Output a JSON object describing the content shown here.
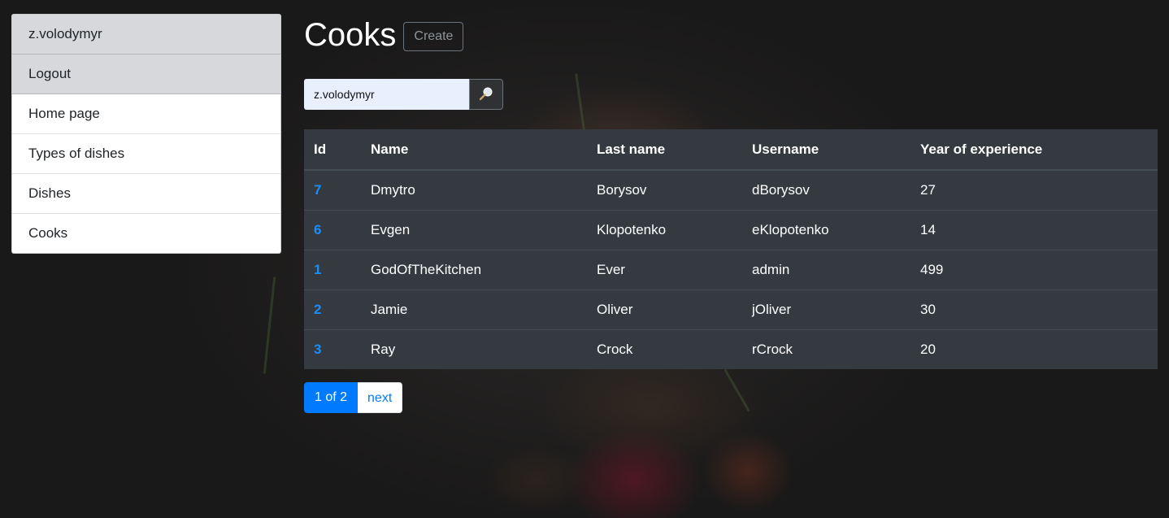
{
  "sidebar": {
    "items": [
      {
        "label": "z.volodymyr"
      },
      {
        "label": "Logout"
      },
      {
        "label": "Home page"
      },
      {
        "label": "Types of dishes"
      },
      {
        "label": "Dishes"
      },
      {
        "label": "Cooks"
      }
    ]
  },
  "main": {
    "title": "Cooks",
    "create_label": "Create",
    "search": {
      "value": "z.volodymyr",
      "button_icon": "magnifier-icon"
    },
    "table": {
      "headers": [
        "Id",
        "Name",
        "Last name",
        "Username",
        "Year of experience"
      ],
      "rows": [
        [
          "7",
          "Dmytro",
          "Borysov",
          "dBorysov",
          "27"
        ],
        [
          "6",
          "Evgen",
          "Klopotenko",
          "eKlopotenko",
          "14"
        ],
        [
          "1",
          "GodOfTheKitchen",
          "Ever",
          "admin",
          "499"
        ],
        [
          "2",
          "Jamie",
          "Oliver",
          "jOliver",
          "30"
        ],
        [
          "3",
          "Ray",
          "Crock",
          "rCrock",
          "20"
        ]
      ]
    },
    "pagination": {
      "current": "1 of 2",
      "next": "next"
    }
  },
  "colors": {
    "accent": "#007bff",
    "table_bg": "#343a40",
    "sidebar_grey": "#d6d8db"
  }
}
